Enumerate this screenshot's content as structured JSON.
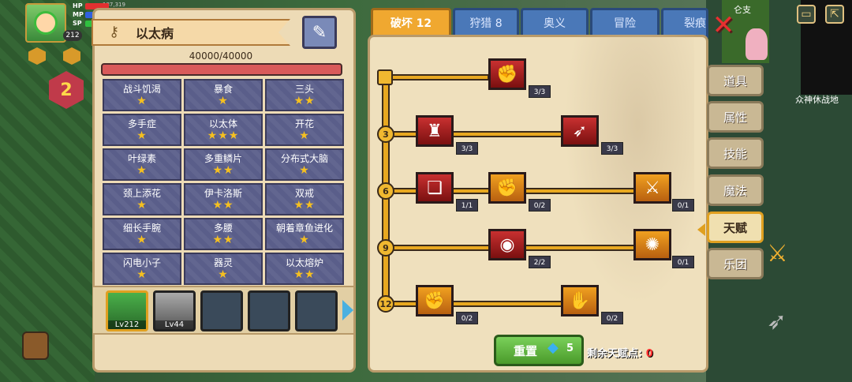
{
  "hud": {
    "hp_label": "HP",
    "mp_label": "MP",
    "sp_label": "SP",
    "hp_value": "187,319",
    "level": "212",
    "stage_number": "2"
  },
  "trait_panel": {
    "title": "以太病",
    "hp_text": "40000/40000",
    "traits": [
      {
        "name": "战斗饥渴",
        "stars": "★"
      },
      {
        "name": "暴食",
        "stars": "★"
      },
      {
        "name": "三头",
        "stars": "★★"
      },
      {
        "name": "多手症",
        "stars": "★"
      },
      {
        "name": "以太体",
        "stars": "★★★"
      },
      {
        "name": "开花",
        "stars": "★"
      },
      {
        "name": "叶绿素",
        "stars": "★"
      },
      {
        "name": "多重鳞片",
        "stars": "★★"
      },
      {
        "name": "分布式大脑",
        "stars": "★"
      },
      {
        "name": "颈上添花",
        "stars": "★"
      },
      {
        "name": "伊卡洛斯",
        "stars": "★★"
      },
      {
        "name": "双戒",
        "stars": "★★"
      },
      {
        "name": "细长手腕",
        "stars": "★"
      },
      {
        "name": "多腰",
        "stars": "★★"
      },
      {
        "name": "朝着章鱼进化",
        "stars": "★"
      },
      {
        "name": "闪电小子",
        "stars": "★"
      },
      {
        "name": "器灵",
        "stars": "★"
      },
      {
        "name": "以太熔炉",
        "stars": "★★"
      }
    ],
    "party": [
      {
        "level": "Lv212"
      },
      {
        "level": "Lv44"
      }
    ]
  },
  "tabs": [
    {
      "label": "破坏 12"
    },
    {
      "label": "狩猎 8"
    },
    {
      "label": "奥义"
    },
    {
      "label": "冒险"
    },
    {
      "label": "裂痕"
    }
  ],
  "tree": {
    "tiers": [
      "3",
      "6",
      "9",
      "12"
    ],
    "skills": [
      {
        "id": "arm-wrestle",
        "icon": "arm-wrestle-icon",
        "count": "3/3"
      },
      {
        "id": "muscle-body",
        "icon": "muscle-body-icon",
        "count": "3/3"
      },
      {
        "id": "heart-arrow",
        "icon": "heart-arrow-icon",
        "count": "3/3"
      },
      {
        "id": "card-strike",
        "icon": "card-strike-icon",
        "count": "1/1"
      },
      {
        "id": "punch",
        "icon": "punch-icon",
        "count": "0/2"
      },
      {
        "id": "spear-splash",
        "icon": "spear-splash-icon",
        "count": "0/1"
      },
      {
        "id": "orb-ring",
        "icon": "orb-ring-icon",
        "count": "2/2"
      },
      {
        "id": "drops-burst",
        "icon": "drops-burst-icon",
        "count": "0/1"
      },
      {
        "id": "fist-raise",
        "icon": "fist-raise-icon",
        "count": "0/2"
      },
      {
        "id": "fist-bandage",
        "icon": "fist-bandage-icon",
        "count": "0/2"
      }
    ]
  },
  "side_nav": [
    {
      "label": "道具"
    },
    {
      "label": "属性"
    },
    {
      "label": "技能"
    },
    {
      "label": "魔法"
    },
    {
      "label": "天赋"
    },
    {
      "label": "乐团"
    }
  ],
  "footer": {
    "reset_label": "重置",
    "gem_cost": "5",
    "remaining_label": "剩余天赋点:",
    "remaining_value": "0"
  },
  "map": {
    "location_label": "众神休战地",
    "top_fragment": "仑支"
  },
  "colors": {
    "active_tab": "#f0a830",
    "inactive_tab": "#4a78b8",
    "tree_line": "#e8a820",
    "red_skill": "#c83030",
    "orange_skill": "#f0a020",
    "reset_green": "#7ad05a",
    "remaining_red": "#ff3030"
  }
}
